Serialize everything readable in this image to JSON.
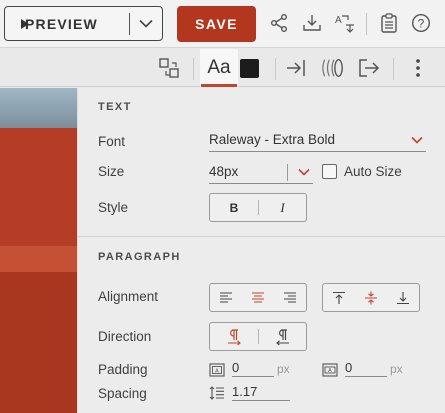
{
  "toolbar": {
    "preview_label": "PREVIEW",
    "save_label": "SAVE",
    "icons": [
      "share-icon",
      "download-icon",
      "translate-icon",
      "clipboard-icon",
      "help-icon"
    ]
  },
  "toolbar2": {
    "text_tab_label": "Aa",
    "text_color": "#1c1c1c",
    "accent_color": "#c0462c",
    "icons": [
      "align-to-object-icon",
      "slide-in-icon",
      "ripple-icon",
      "exit-icon",
      "more-vertical-icon"
    ]
  },
  "panel": {
    "text_section": {
      "title": "TEXT",
      "font_label": "Font",
      "font_value": "Raleway - Extra Bold",
      "size_label": "Size",
      "size_value": "48px",
      "auto_size_label": "Auto Size",
      "style_label": "Style",
      "bold_label": "B",
      "italic_label": "I"
    },
    "paragraph_section": {
      "title": "PARAGRAPH",
      "alignment_label": "Alignment",
      "direction_label": "Direction",
      "padding_label": "Padding",
      "padding_horizontal": "0",
      "padding_vertical": "0",
      "padding_unit": "px",
      "spacing_label": "Spacing",
      "spacing_value": "1.17"
    }
  }
}
